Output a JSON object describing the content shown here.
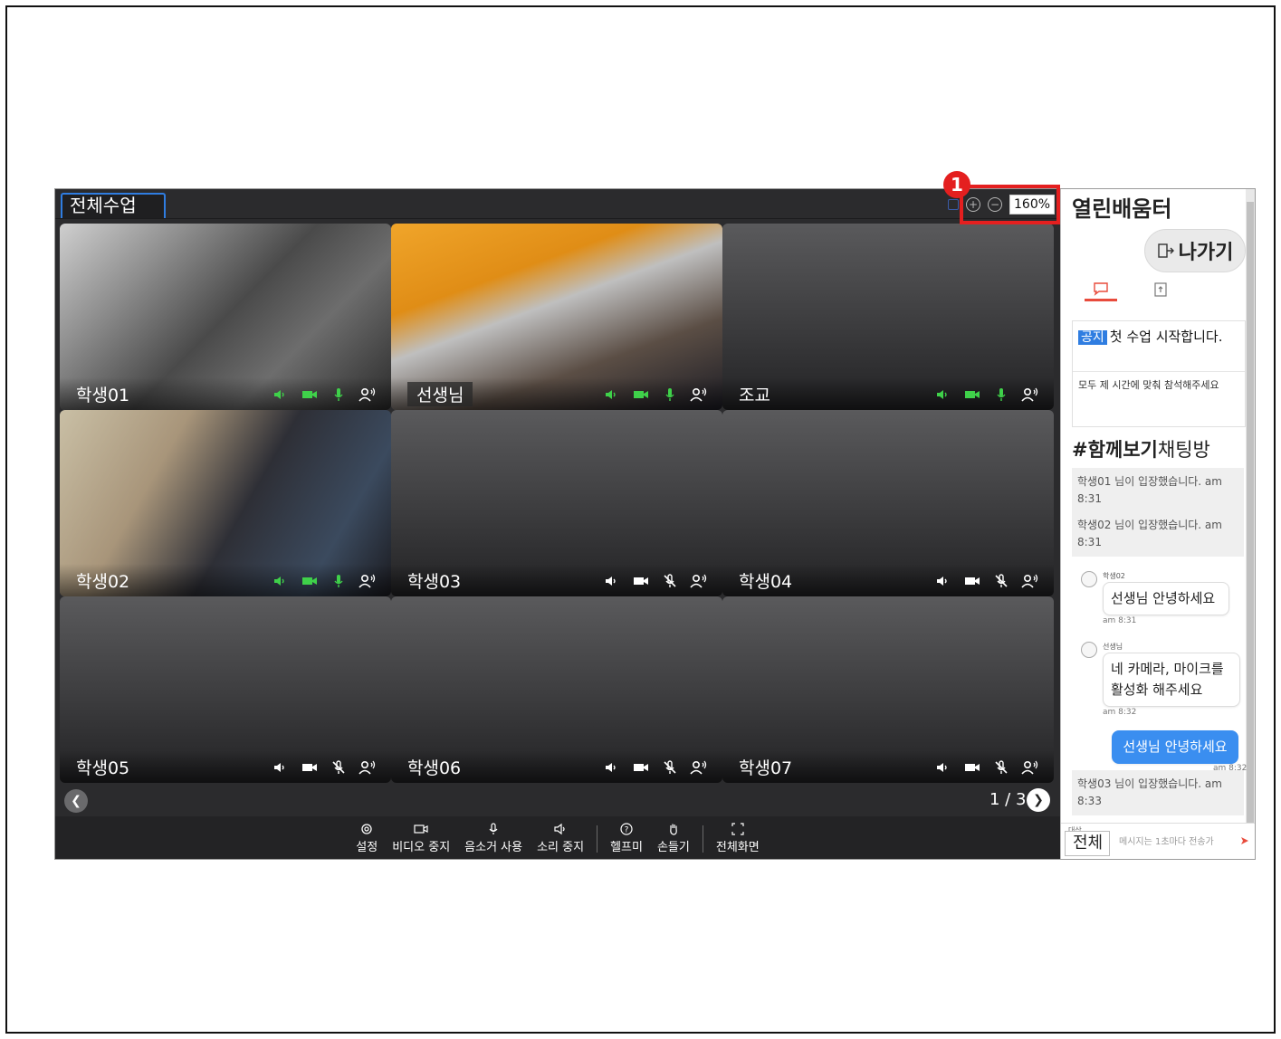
{
  "marker": "1",
  "app": {
    "tab_title": "전체수업",
    "zoom_level": "160%",
    "zoom_in_icon": "plus-circle-icon",
    "zoom_out_icon": "minus-circle-icon"
  },
  "tiles": [
    {
      "name": "학생01",
      "style": "cam1",
      "tag": false,
      "status": "green"
    },
    {
      "name": "선생님",
      "style": "cam2",
      "tag": true,
      "status": "green"
    },
    {
      "name": "조교",
      "style": "blank",
      "tag": false,
      "status": "green-big"
    },
    {
      "name": "학생02",
      "style": "cam3",
      "tag": false,
      "status": "green"
    },
    {
      "name": "학생03",
      "style": "blank",
      "tag": false,
      "status": "white-muted"
    },
    {
      "name": "학생04",
      "style": "blank",
      "tag": false,
      "status": "white-muted"
    },
    {
      "name": "학생05",
      "style": "blank",
      "tag": false,
      "status": "white-muted"
    },
    {
      "name": "학생06",
      "style": "blank",
      "tag": false,
      "status": "white-muted"
    },
    {
      "name": "학생07",
      "style": "blank",
      "tag": false,
      "status": "white-muted"
    }
  ],
  "pager": {
    "text": "1 / 3"
  },
  "toolbar": {
    "settings": "설정",
    "video_stop": "비디오 중지",
    "mute": "음소거 사용",
    "sound_stop": "소리 중지",
    "help": "헬프미",
    "raise_hand": "손들기",
    "fullscreen": "전체화면"
  },
  "sidebar": {
    "title": "열린배움터",
    "exit": "나가기",
    "notice_tag": "공지",
    "notice_title": "첫 수업 시작합니다.",
    "notice_body": "모두 제 시간에 맞춰 참석해주세요",
    "chat_room_hash": "#함께보기",
    "chat_room_name": "채팅방",
    "messages": {
      "sys1": "학생01 님이 입장했습니다. am 8:31",
      "sys2": "학생02 님이 입장했습니다. am 8:31",
      "m1_sender": "학생02",
      "m1_text": "선생님 안녕하세요",
      "m1_time": "am 8:31",
      "m2_sender": "선생님",
      "m2_text": "네 카메라, 마이크를 활성화 해주세요",
      "m2_time": "am 8:32",
      "m3_text": "선생님 안녕하세요",
      "m3_time": "am 8:32",
      "sys3": "학생03 님이 입장했습니다. am 8:33"
    },
    "target_label": "대상",
    "target_value": "전체",
    "input_placeholder": "메시지는 1초마다 전송가"
  },
  "colors": {
    "accent_blue": "#2f7de1",
    "highlight_red": "#e41f1f",
    "status_green": "#3fd14a"
  }
}
